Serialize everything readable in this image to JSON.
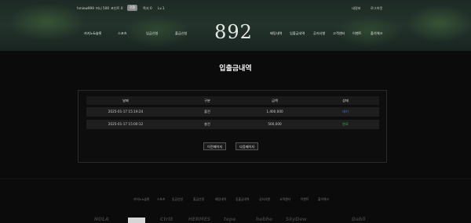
{
  "topbar": {
    "user": "hmiew999",
    "money_label": "머니 500",
    "point_label": "포인트 0",
    "convert_btn": "전환",
    "note_label": "쪽지 0",
    "level_label": "Lv.1",
    "mypage": "내정보",
    "logout": "로그아웃"
  },
  "nav_left": [
    "카지노&슬롯",
    "스포츠",
    "입금신청",
    "출금신청"
  ],
  "logo": "892",
  "nav_right": [
    "배팅내역",
    "입출금내역",
    "공지사항",
    "고객센터",
    "이벤트",
    "출석체크"
  ],
  "page_title": "입출금내역",
  "table": {
    "headers": [
      "날짜",
      "구분",
      "금액",
      "상태"
    ],
    "rows": [
      {
        "date": "2025-01-17 15:19:24",
        "type": "출전",
        "amount": "1,400,000",
        "status": "대기"
      },
      {
        "date": "2025-01-17 15:00:12",
        "type": "충전",
        "amount": "500,000",
        "status": "완료"
      }
    ]
  },
  "pagination": {
    "prev": "이전페이지",
    "next": "다음페이지"
  },
  "footer_links": [
    "카지노&슬롯",
    "스포츠",
    "입금신청",
    "출금신청",
    "배팅내역",
    "입출금내역",
    "공지사항",
    "고객센터",
    "이벤트",
    "출석체크"
  ],
  "partners": [
    "NOLA",
    "Ctrl8",
    "HERMES",
    "tepe",
    "hebhe",
    "SkyDew",
    "Dabli"
  ],
  "colors": {
    "status_pending": "#4f7bd6",
    "status_done": "#3fae4a"
  }
}
